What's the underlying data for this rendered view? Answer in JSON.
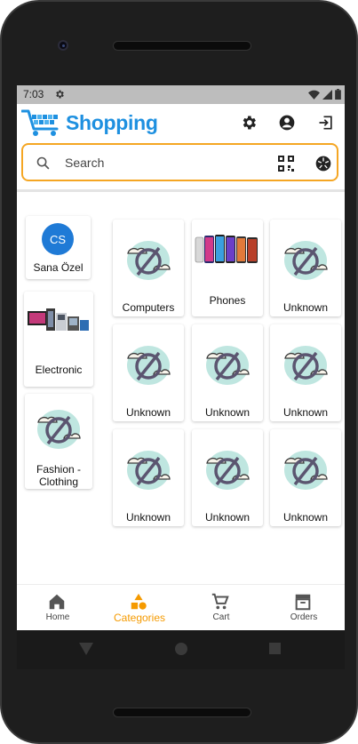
{
  "status": {
    "time": "7:03"
  },
  "app": {
    "title": "Shopping"
  },
  "search": {
    "placeholder": "Search"
  },
  "sidebar": [
    {
      "label": "Sana Özel",
      "avatar": "CS",
      "image": "avatar"
    },
    {
      "label": "Electronic",
      "image": "electronics-photo"
    },
    {
      "label": "Fashion - Clothing",
      "image": "placeholder"
    }
  ],
  "grid": [
    {
      "label": "Computers",
      "image": "placeholder"
    },
    {
      "label": "Phones",
      "image": "phones-photo"
    },
    {
      "label": "Unknown",
      "image": "placeholder"
    },
    {
      "label": "Unknown",
      "image": "placeholder"
    },
    {
      "label": "Unknown",
      "image": "placeholder"
    },
    {
      "label": "Unknown",
      "image": "placeholder"
    },
    {
      "label": "Unknown",
      "image": "placeholder"
    },
    {
      "label": "Unknown",
      "image": "placeholder"
    },
    {
      "label": "Unknown",
      "image": "placeholder"
    }
  ],
  "nav": {
    "active": "Categories",
    "items": [
      {
        "label": "Home",
        "icon": "home-icon"
      },
      {
        "label": "Categories",
        "icon": "categories-icon"
      },
      {
        "label": "Cart",
        "icon": "cart-icon"
      },
      {
        "label": "Orders",
        "icon": "orders-icon"
      }
    ]
  },
  "colors": {
    "brand": "#1e90e0",
    "accent": "#f5a623",
    "active_nav": "#f59a00",
    "avatar": "#1f7ad6"
  }
}
